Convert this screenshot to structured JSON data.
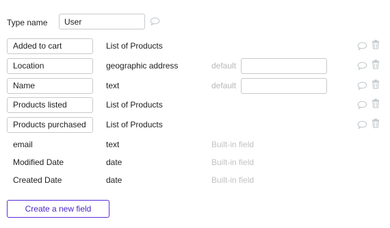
{
  "type_name": {
    "label": "Type name",
    "value": "User"
  },
  "fields": [
    {
      "name": "Added to cart",
      "type": "List of Products"
    },
    {
      "name": "Location",
      "type": "geographic address",
      "default_label": "default",
      "default_value": ""
    },
    {
      "name": "Name",
      "type": "text",
      "default_label": "default",
      "default_value": ""
    },
    {
      "name": "Products listed",
      "type": "List of Products"
    },
    {
      "name": "Products purchased",
      "type": "List of Products"
    }
  ],
  "builtin_fields": [
    {
      "name": "email",
      "type": "text",
      "note": "Built-in field"
    },
    {
      "name": "Modified Date",
      "type": "date",
      "note": "Built-in field"
    },
    {
      "name": "Created Date",
      "type": "date",
      "note": "Built-in field"
    }
  ],
  "create_button": "Create a new field",
  "icons": {
    "comment": "comment-icon",
    "trash": "trash-icon"
  },
  "colors": {
    "accent": "#5b2bd8",
    "icon": "#c4c9cc",
    "muted_text": "#b8b8b8"
  }
}
